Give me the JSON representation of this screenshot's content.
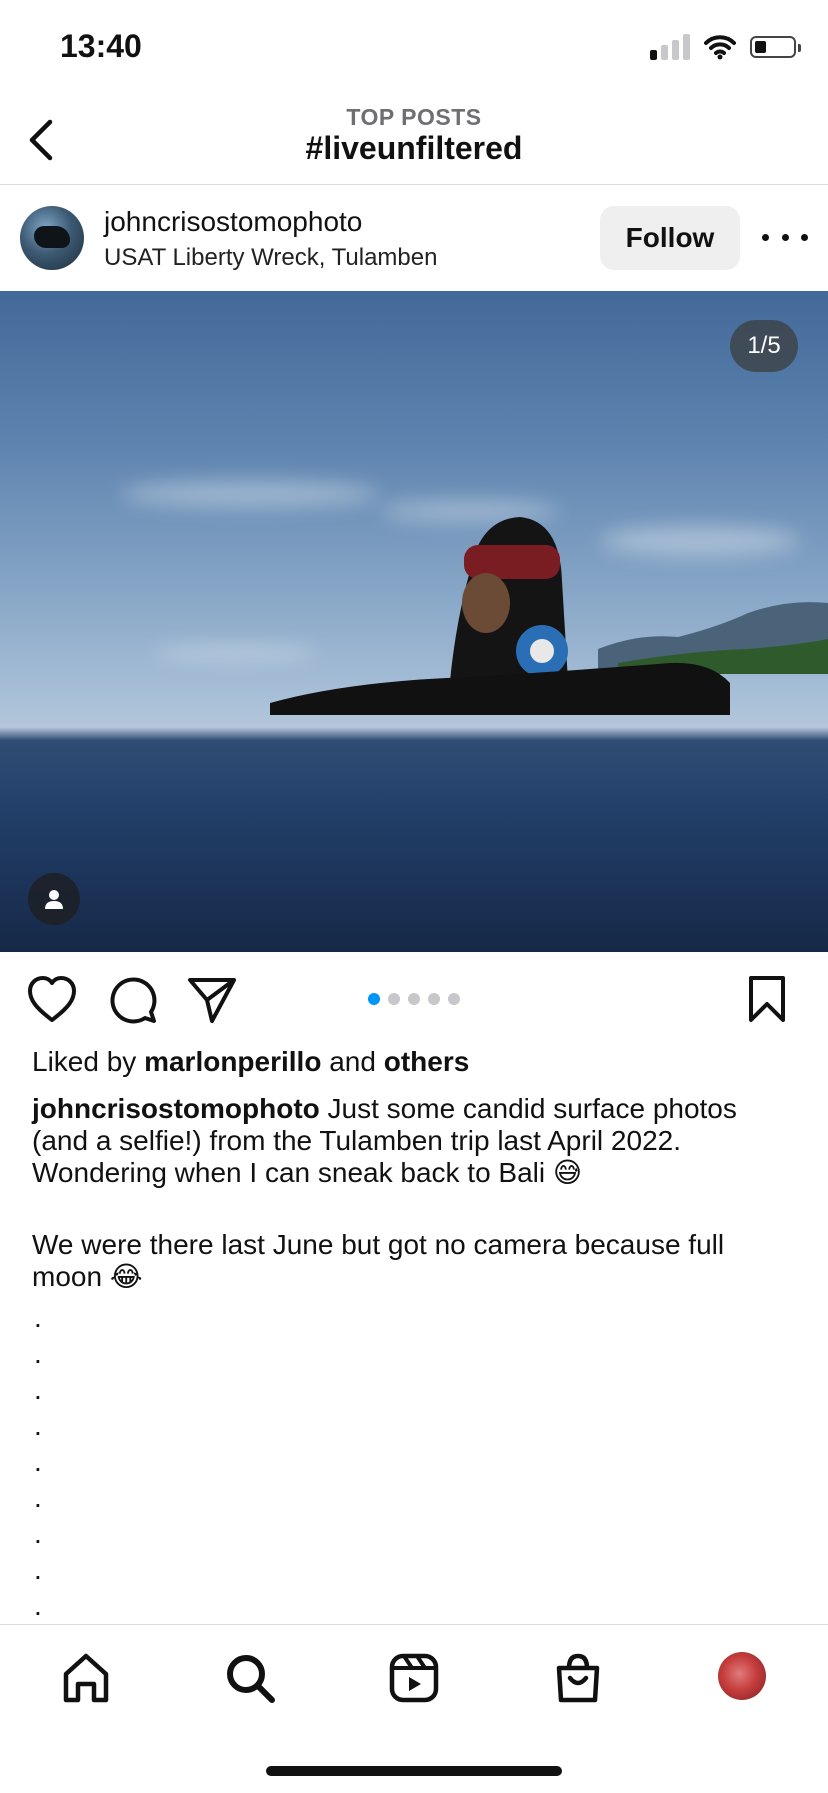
{
  "status_bar": {
    "time": "13:40",
    "signal_bars_active": 1,
    "signal_bars_total": 4,
    "battery_level": 0.3
  },
  "header": {
    "subtitle": "TOP POSTS",
    "title": "#liveunfiltered"
  },
  "post": {
    "username": "johncrisostomophoto",
    "location": "USAT Liberty Wreck, Tulamben",
    "follow_label": "Follow",
    "image_counter": "1/5",
    "carousel": {
      "count": 5,
      "active_index": 0
    },
    "likes": {
      "prefix": "Liked by",
      "user": "marlonperillo",
      "middle": "and",
      "others": "others"
    },
    "caption": {
      "username": "johncrisostomophoto",
      "text": "Just some candid surface photos (and a selfie!) from the Tulamben trip last April 2022. Wondering when I can sneak back to Bali 😅",
      "second_paragraph": "We were there last June but got no camera because full moon 😂",
      "trailing_dots": ".\n.\n.\n.\n.\n.\n.\n.\n."
    }
  },
  "icons": {
    "back": "chevron-left-icon",
    "more": "more-horizontal-icon",
    "like": "heart-icon",
    "comment": "comment-icon",
    "share": "paper-plane-icon",
    "save": "bookmark-icon",
    "tag": "user-tag-icon"
  },
  "tab_bar": [
    "home",
    "search",
    "reels",
    "shop",
    "profile"
  ],
  "colors": {
    "accent": "#0095f6",
    "follow_bg": "#efefef",
    "divider": "#dbdbdb"
  }
}
